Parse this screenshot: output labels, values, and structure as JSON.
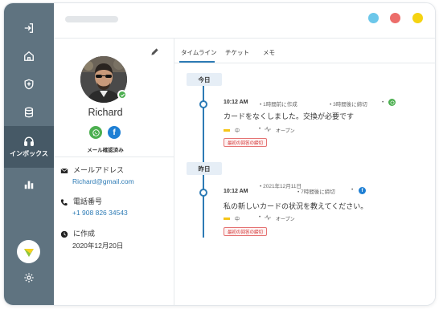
{
  "sidebar": {
    "active_label": "インボックス"
  },
  "window": {
    "dot_colors": [
      "#6cc7ea",
      "#ec6d6a",
      "#f5d311"
    ]
  },
  "profile": {
    "name": "Richard",
    "channels_label": "メール確認済み",
    "email_label": "メールアドレス",
    "email_value": "Richard@gmail.com",
    "phone_label": "電話番号",
    "phone_value": "+1 908 826 34543",
    "created_label": "に作成",
    "created_value": "2020年12月20日"
  },
  "tabs": [
    "タイムライン",
    "チケット",
    "メモ"
  ],
  "timeline": [
    {
      "day": "今日",
      "time": "10:12 AM",
      "created": "1時間前に作成",
      "deadline": "3時間後に締切",
      "message": "カードをなくしました。交換が必要です",
      "priority": "中",
      "status": "オープン",
      "tag": "最初の回答の締切",
      "source_icon": "whatsapp-icon"
    },
    {
      "day": "昨日",
      "time": "10:12 AM",
      "created": "2021年12月11日",
      "deadline": "7時間後に締切",
      "message": "私の新しいカードの状況を教えてください。",
      "priority": "中",
      "status": "オープン",
      "tag": "最初の回答の締切",
      "source_icon": "facebook-icon"
    }
  ]
}
